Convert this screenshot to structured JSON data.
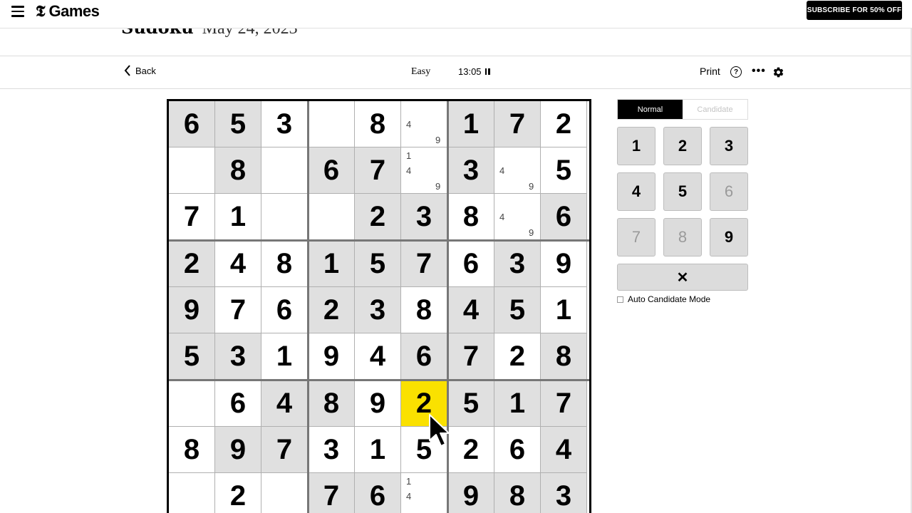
{
  "nav": {
    "logo_mark": "𝕿",
    "logo_text": "Games",
    "subscribe_label": "SUBSCRIBE FOR 50% OFF"
  },
  "title": {
    "game": "Sudoku",
    "date": "May 24, 2023"
  },
  "toolbar": {
    "back_label": "Back",
    "difficulty": "Easy",
    "timer": "13:05",
    "print_label": "Print",
    "help_label": "?",
    "more_label": "•••"
  },
  "board": {
    "cells": [
      [
        "6",
        "5",
        "3",
        "",
        "8",
        "",
        "1",
        "7",
        "2"
      ],
      [
        "",
        "8",
        "",
        "6",
        "7",
        "",
        "3",
        "",
        "5"
      ],
      [
        "7",
        "1",
        "",
        "",
        "2",
        "3",
        "8",
        "",
        "6"
      ],
      [
        "2",
        "4",
        "8",
        "1",
        "5",
        "7",
        "6",
        "3",
        "9"
      ],
      [
        "9",
        "7",
        "6",
        "2",
        "3",
        "8",
        "4",
        "5",
        "1"
      ],
      [
        "5",
        "3",
        "1",
        "9",
        "4",
        "6",
        "7",
        "2",
        "8"
      ],
      [
        "",
        "6",
        "4",
        "8",
        "9",
        "2",
        "5",
        "1",
        "7"
      ],
      [
        "8",
        "9",
        "7",
        "3",
        "1",
        "5",
        "2",
        "6",
        "4"
      ],
      [
        "",
        "2",
        "",
        "7",
        "6",
        "",
        "9",
        "8",
        "3"
      ]
    ],
    "given": [
      [
        1,
        1,
        0,
        0,
        0,
        0,
        1,
        1,
        0
      ],
      [
        0,
        1,
        0,
        1,
        1,
        0,
        1,
        0,
        0
      ],
      [
        0,
        0,
        0,
        0,
        1,
        1,
        0,
        0,
        1
      ],
      [
        1,
        0,
        0,
        1,
        1,
        1,
        0,
        1,
        0
      ],
      [
        1,
        0,
        0,
        1,
        1,
        0,
        1,
        1,
        0
      ],
      [
        1,
        1,
        0,
        0,
        0,
        1,
        1,
        0,
        1
      ],
      [
        0,
        0,
        1,
        1,
        0,
        0,
        1,
        1,
        1
      ],
      [
        0,
        1,
        1,
        0,
        0,
        0,
        0,
        0,
        1
      ],
      [
        0,
        0,
        0,
        1,
        1,
        0,
        1,
        1,
        1
      ]
    ],
    "selected": [
      6,
      5
    ],
    "notes": [
      {
        "row": 0,
        "col": 5,
        "digits": [
          "4",
          "9"
        ]
      },
      {
        "row": 1,
        "col": 5,
        "digits": [
          "1",
          "4",
          "9"
        ]
      },
      {
        "row": 1,
        "col": 7,
        "digits": [
          "4",
          "9"
        ]
      },
      {
        "row": 2,
        "col": 7,
        "digits": [
          "4",
          "9"
        ]
      },
      {
        "row": 8,
        "col": 5,
        "digits": [
          "1",
          "4"
        ]
      }
    ]
  },
  "panel": {
    "mode_normal": "Normal",
    "mode_candidate": "Candidate",
    "keys": [
      {
        "label": "1",
        "disabled": false
      },
      {
        "label": "2",
        "disabled": false
      },
      {
        "label": "3",
        "disabled": false
      },
      {
        "label": "4",
        "disabled": false
      },
      {
        "label": "5",
        "disabled": false
      },
      {
        "label": "6",
        "disabled": true
      },
      {
        "label": "7",
        "disabled": true
      },
      {
        "label": "8",
        "disabled": true
      },
      {
        "label": "9",
        "disabled": false
      }
    ],
    "erase_label": "✕",
    "auto_candidate_label": "Auto Candidate Mode"
  }
}
